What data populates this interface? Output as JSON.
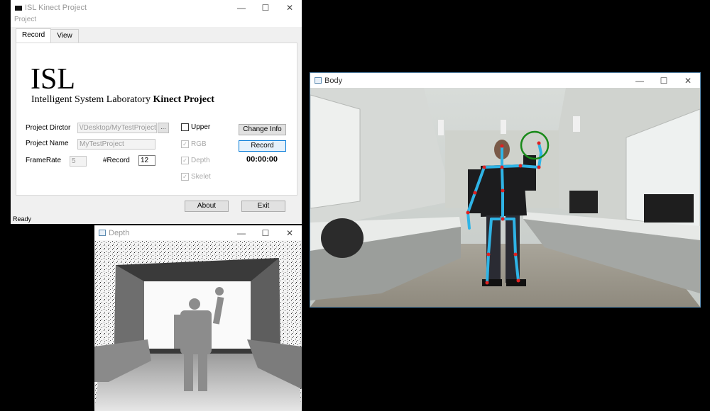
{
  "main_window": {
    "title": "ISL Kinect Project",
    "menu": "Project",
    "tabs": [
      {
        "label": "Record"
      },
      {
        "label": "View"
      }
    ],
    "logo_big": "ISL",
    "logo_sub_plain": "Intelligent System Laboratory",
    "logo_sub_bold": "Kinect Project",
    "labels": {
      "project_dir": "Project Dirctor",
      "project_name": "Project Name",
      "framerate": "FrameRate",
      "record": "#Record"
    },
    "values": {
      "project_dir": "\\/Desktop/MyTestProject",
      "project_name": "MyTestProject",
      "framerate": "5",
      "record_count": "12"
    },
    "browse_label": "...",
    "checkboxes": [
      {
        "label": "Upper",
        "checked": false,
        "enabled": true
      },
      {
        "label": "RGB",
        "checked": true,
        "enabled": false
      },
      {
        "label": "Depth",
        "checked": true,
        "enabled": false
      },
      {
        "label": "Skelet",
        "checked": true,
        "enabled": false
      }
    ],
    "buttons": {
      "change_info": "Change Info",
      "record": "Record",
      "about": "About",
      "exit": "Exit"
    },
    "timer": "00:00:00",
    "status": "Ready"
  },
  "depth_window": {
    "title": "Depth"
  },
  "body_window": {
    "title": "Body"
  },
  "window_controls": {
    "minimize": "—",
    "maximize": "☐",
    "close": "✕"
  },
  "colors": {
    "skeleton": "#2fb4e6",
    "joints": "#e02020",
    "hand_circle": "#1a8a1a",
    "window_border": "#5a8ab0"
  }
}
